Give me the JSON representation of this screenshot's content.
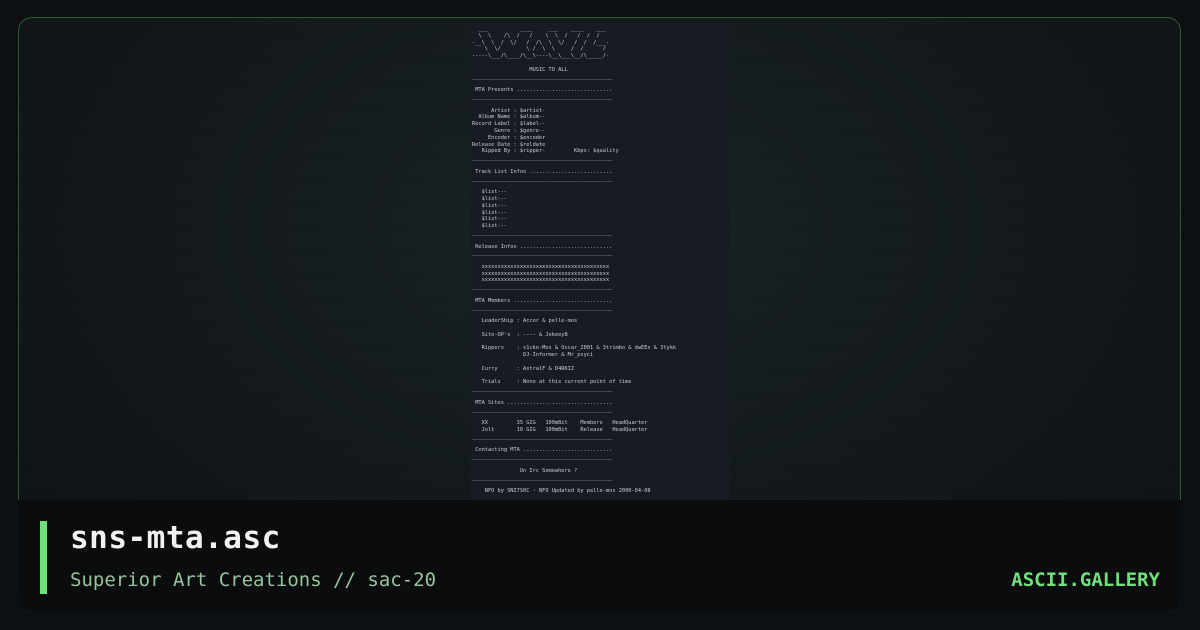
{
  "card": {
    "title": "sns-mta.asc",
    "subtitle": "Superior Art Creations // sac-20",
    "brand": "ASCII.GALLERY"
  },
  "art": {
    "text": "  ___          ____     ___    ____    ___\n  \\  \\    /\\  /   /    \\  \\  /   /  /  /\n-__\\  \\  /  \\/   /  /\\  \\  \\/   /  /  /___-\n    \\  \\/        \\ /  \\  \\     /  /      /\n-----\\___/\\____/\\__\\----\\__\\___\\__/\\_____/-\n\n                  MUSIC TO ALL\n____________________________________________\n\n MTA Presents ..............................\n____________________________________________\n\n      Artist : $artist-\n  Album Name : $album--\nRecord Label : $label--\n       Genre : $genre--\n     Encoder : $encoder\nRelease Date : $reldate\n   Ripped By : $ripper-         Kbps: $quality\n____________________________________________\n\n Track List Infos ..........................\n____________________________________________\n\n   $list---\n   $list---\n   $list---\n   $list---\n   $list---\n   $list---\n____________________________________________\n\n Release Infos .............................\n____________________________________________\n\n   xxxxxxxxxxxxxxxxxxxxxxxxxxxxxxxxxxxxxxxx\n   xxxxxxxxxxxxxxxxxxxxxxxxxxxxxxxxxxxxxxxx\n   xxxxxxxxxxxxxxxxxxxxxxxxxxxxxxxxxxxxxxxx\n____________________________________________\n\n MTA Members ...............................\n____________________________________________\n\n   LeaderShip : Accor & pelle-mos\n\n   Site-OP's  : ---- & Jokeey8\n\n   Rippers    : s1cko-Mos & Oscar_2001 & 3trimbo & dwEEx & 3tykk\n                DJ-Informer & Mr_psyci\n\n   Curry      : AstralF & D4RKIZ\n\n   Trials     : None at this current point of time\n____________________________________________\n\n MTA Sites .................................\n____________________________________________\n\n   XX         35 GIG   100mBit    Members   HeadQuarter\n   Jolt       10 GIG   100mBit    Release   HeadQuarter\n____________________________________________\n\n Contacting MTA ............................\n____________________________________________\n\n               On Irc Somewhere ?\n____________________________________________\n\n    NFO by SNI7S0C - NFO Updated by pelle-mos 2000-04-08"
  }
}
